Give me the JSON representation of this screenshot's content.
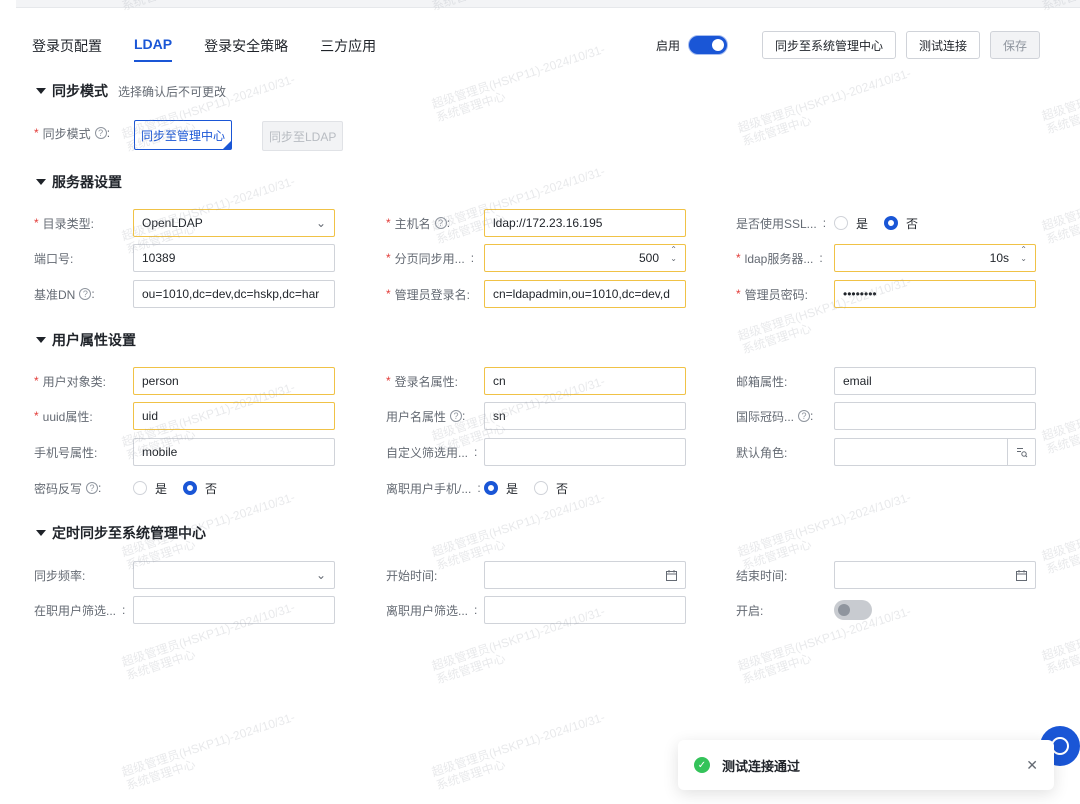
{
  "tabs": [
    "登录页配置",
    "LDAP",
    "登录安全策略",
    "三方应用"
  ],
  "toolbar": {
    "enable_label": "启用",
    "sync_button": "同步至系统管理中心",
    "test_button": "测试连接",
    "save_button": "保存"
  },
  "sections": {
    "sync_mode": {
      "title": "同步模式",
      "hint": "选择确认后不可更改"
    },
    "server": {
      "title": "服务器设置"
    },
    "user_attr": {
      "title": "用户属性设置"
    },
    "schedule": {
      "title": "定时同步至系统管理中心"
    }
  },
  "sync_mode": {
    "label": "同步模式",
    "option_on": "同步至管理中心",
    "option_off": "同步至LDAP"
  },
  "server": {
    "dir_type": {
      "label": "目录类型:",
      "value": "OpenLDAP"
    },
    "host": {
      "label": "主机名",
      "value": "ldap://172.23.16.195"
    },
    "ssl": {
      "label": "是否使用SSL...",
      "yes": "是",
      "no": "否"
    },
    "port": {
      "label": "端口号:",
      "value": "10389"
    },
    "page_sync": {
      "label": "分页同步用...",
      "value": "500"
    },
    "ldap_timeout": {
      "label": "ldap服务器...",
      "value": "10s"
    },
    "base_dn": {
      "label": "基准DN",
      "value": "ou=1010,dc=dev,dc=hskp,dc=har"
    },
    "admin_login": {
      "label": "管理员登录名:",
      "value": "cn=ldapadmin,ou=1010,dc=dev,d"
    },
    "admin_pwd": {
      "label": "管理员密码:",
      "value": "••••••••"
    }
  },
  "user_attr": {
    "object_class": {
      "label": "用户对象类:",
      "value": "person"
    },
    "login_attr": {
      "label": "登录名属性:",
      "value": "cn"
    },
    "email_attr": {
      "label": "邮箱属性:",
      "value": "email"
    },
    "uuid_attr": {
      "label": "uuid属性:",
      "value": "uid"
    },
    "username_attr": {
      "label": "用户名属性",
      "value": "sn"
    },
    "country_code": {
      "label": "国际冠码...",
      "value": ""
    },
    "phone_attr": {
      "label": "手机号属性:",
      "value": "mobile"
    },
    "custom_filter": {
      "label": "自定义筛选用...",
      "value": ""
    },
    "default_role": {
      "label": "默认角色:",
      "value": ""
    },
    "pwd_writeback": {
      "label": "密码反写",
      "yes": "是",
      "no": "否"
    },
    "leave_phone": {
      "label": "离职用户手机/...",
      "yes": "是",
      "no": "否"
    }
  },
  "schedule": {
    "frequency": {
      "label": "同步频率:"
    },
    "start": {
      "label": "开始时间:"
    },
    "end": {
      "label": "结束时间:"
    },
    "active_filter": {
      "label": "在职用户筛选..."
    },
    "left_filter": {
      "label": "离职用户筛选..."
    },
    "enable": {
      "label": "开启:"
    }
  },
  "watermark": {
    "line1": "超级管理员(HSKP11)-2024/10/31-",
    "line2": "系统管理中心"
  },
  "toast": {
    "message": "测试连接通过"
  },
  "colors": {
    "primary": "#1a56d6",
    "required": "#e23c39",
    "warn_border": "#f0c246",
    "success": "#34c35a"
  }
}
